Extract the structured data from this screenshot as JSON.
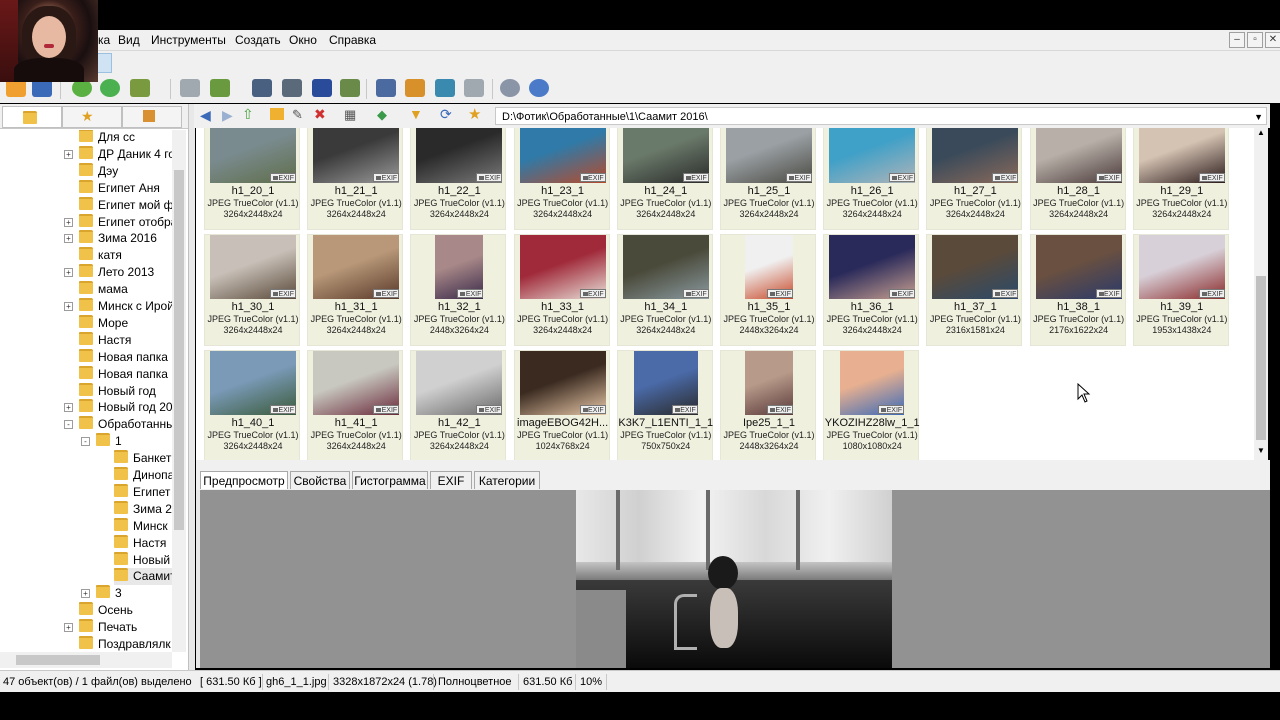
{
  "menu": [
    "Вид",
    "Инструменты",
    "Создать",
    "Окно",
    "Справка"
  ],
  "menu_prefix": "ка",
  "path": "D:\\Фотик\\Обработанные\\1\\Саамит 2016\\",
  "tree": [
    {
      "label": "Для сс",
      "indent": 0,
      "exp": false
    },
    {
      "label": "ДР Даник 4 го,",
      "indent": 0,
      "exp": "+"
    },
    {
      "label": "Дэу",
      "indent": 0,
      "exp": false
    },
    {
      "label": "Египет Аня",
      "indent": 0,
      "exp": false
    },
    {
      "label": "Египет мой фо",
      "indent": 0,
      "exp": false
    },
    {
      "label": "Египет отобра",
      "indent": 0,
      "exp": "+"
    },
    {
      "label": "Зима 2016",
      "indent": 0,
      "exp": "+"
    },
    {
      "label": "катя",
      "indent": 0,
      "exp": false
    },
    {
      "label": "Лето 2013",
      "indent": 0,
      "exp": "+"
    },
    {
      "label": "мама",
      "indent": 0,
      "exp": false
    },
    {
      "label": "Минск с Ирой",
      "indent": 0,
      "exp": "+"
    },
    {
      "label": "Море",
      "indent": 0,
      "exp": false
    },
    {
      "label": "Настя",
      "indent": 0,
      "exp": false
    },
    {
      "label": "Новая папка",
      "indent": 0,
      "exp": false
    },
    {
      "label": "Новая папка (.",
      "indent": 0,
      "exp": false
    },
    {
      "label": "Новый год",
      "indent": 0,
      "exp": false
    },
    {
      "label": "Новый год 20'",
      "indent": 0,
      "exp": "+"
    },
    {
      "label": "Обработанны",
      "indent": 0,
      "exp": "-"
    },
    {
      "label": "1",
      "indent": 1,
      "exp": "-"
    },
    {
      "label": "Банкет",
      "indent": 2,
      "exp": false
    },
    {
      "label": "Динопа",
      "indent": 2,
      "exp": false
    },
    {
      "label": "Египет",
      "indent": 2,
      "exp": false
    },
    {
      "label": "Зима 2(",
      "indent": 2,
      "exp": false
    },
    {
      "label": "Минск",
      "indent": 2,
      "exp": false
    },
    {
      "label": "Настя",
      "indent": 2,
      "exp": false
    },
    {
      "label": "Новый",
      "indent": 2,
      "exp": false
    },
    {
      "label": "Саамит",
      "indent": 2,
      "exp": false,
      "selected": true
    },
    {
      "label": "3",
      "indent": 1,
      "exp": "+"
    },
    {
      "label": "Осень",
      "indent": 0,
      "exp": false
    },
    {
      "label": "Печать",
      "indent": 0,
      "exp": "+"
    },
    {
      "label": "Поздравлялк",
      "indent": 0,
      "exp": false
    }
  ],
  "thumbs": [
    {
      "name": "h1_20_1",
      "fmt": "JPEG TrueColor (v1.1)",
      "dim": "3264x2448x24",
      "c1": "#7a8b8f",
      "c2": "#5f6e4a"
    },
    {
      "name": "h1_21_1",
      "fmt": "JPEG TrueColor (v1.1)",
      "dim": "3264x2448x24",
      "c1": "#3a3a3a",
      "c2": "#9a9a9a"
    },
    {
      "name": "h1_22_1",
      "fmt": "JPEG TrueColor (v1.1)",
      "dim": "3264x2448x24",
      "c1": "#2a2a2a",
      "c2": "#7a7a7a"
    },
    {
      "name": "h1_23_1",
      "fmt": "JPEG TrueColor (v1.1)",
      "dim": "3264x2448x24",
      "c1": "#2f7aa8",
      "c2": "#b84a2a"
    },
    {
      "name": "h1_24_1",
      "fmt": "JPEG TrueColor (v1.1)",
      "dim": "3264x2448x24",
      "c1": "#6a7a6a",
      "c2": "#2a2a2a"
    },
    {
      "name": "h1_25_1",
      "fmt": "JPEG TrueColor (v1.1)",
      "dim": "3264x2448x24",
      "c1": "#9aa0a4",
      "c2": "#4a4a42"
    },
    {
      "name": "h1_26_1",
      "fmt": "JPEG TrueColor (v1.1)",
      "dim": "3264x2448x24",
      "c1": "#3fa0c8",
      "c2": "#b0b4b8"
    },
    {
      "name": "h1_27_1",
      "fmt": "JPEG TrueColor (v1.1)",
      "dim": "3264x2448x24",
      "c1": "#3a4a5a",
      "c2": "#8a6a5a"
    },
    {
      "name": "h1_28_1",
      "fmt": "JPEG TrueColor (v1.1)",
      "dim": "3264x2448x24",
      "c1": "#b8b0a8",
      "c2": "#4a3a3a"
    },
    {
      "name": "h1_29_1",
      "fmt": "JPEG TrueColor (v1.1)",
      "dim": "3264x2448x24",
      "c1": "#d4c2b2",
      "c2": "#2a1a1a"
    },
    {
      "name": "h1_30_1",
      "fmt": "JPEG TrueColor (v1.1)",
      "dim": "3264x2448x24",
      "c1": "#c8c0b8",
      "c2": "#5a4a3a"
    },
    {
      "name": "h1_31_1",
      "fmt": "JPEG TrueColor (v1.1)",
      "dim": "3264x2448x24",
      "c1": "#b89878",
      "c2": "#5a3a2a"
    },
    {
      "name": "h1_32_1",
      "fmt": "JPEG TrueColor (v1.1)",
      "dim": "2448x3264x24",
      "c1": "#a88888",
      "c2": "#3a2a4a"
    },
    {
      "name": "h1_33_1",
      "fmt": "JPEG TrueColor (v1.1)",
      "dim": "3264x2448x24",
      "c1": "#a02a3a",
      "c2": "#e8e0d8"
    },
    {
      "name": "h1_34_1",
      "fmt": "JPEG TrueColor (v1.1)",
      "dim": "3264x2448x24",
      "c1": "#4a4a3a",
      "c2": "#8a9aa0"
    },
    {
      "name": "h1_35_1",
      "fmt": "JPEG TrueColor (v1.1)",
      "dim": "2448x3264x24",
      "c1": "#f0f0f0",
      "c2": "#c84a2a"
    },
    {
      "name": "h1_36_1",
      "fmt": "JPEG TrueColor (v1.1)",
      "dim": "3264x2448x24",
      "c1": "#2a2a5a",
      "c2": "#c8a090"
    },
    {
      "name": "h1_37_1",
      "fmt": "JPEG TrueColor (v1.1)",
      "dim": "2316x1581x24",
      "c1": "#5a4a3a",
      "c2": "#2a4a6a"
    },
    {
      "name": "h1_38_1",
      "fmt": "JPEG TrueColor (v1.1)",
      "dim": "2176x1622x24",
      "c1": "#6a5040",
      "c2": "#2a3a6a"
    },
    {
      "name": "h1_39_1",
      "fmt": "JPEG TrueColor (v1.1)",
      "dim": "1953x1438x24",
      "c1": "#d8d0d8",
      "c2": "#8a2a2a"
    },
    {
      "name": "h1_40_1",
      "fmt": "JPEG TrueColor (v1.1)",
      "dim": "3264x2448x24",
      "c1": "#7a9ab8",
      "c2": "#3a5a3a"
    },
    {
      "name": "h1_41_1",
      "fmt": "JPEG TrueColor (v1.1)",
      "dim": "3264x2448x24",
      "c1": "#c8c8c0",
      "c2": "#6a2a3a"
    },
    {
      "name": "h1_42_1",
      "fmt": "JPEG TrueColor (v1.1)",
      "dim": "3264x2448x24",
      "c1": "#d0d0d0",
      "c2": "#6a6a6a"
    },
    {
      "name": "imageEBOG42H...",
      "fmt": "JPEG TrueColor (v1.1)",
      "dim": "1024x768x24",
      "c1": "#3a2a20",
      "c2": "#e8c8a8"
    },
    {
      "name": "K3K7_L1ENTI_1_1",
      "fmt": "JPEG TrueColor (v1.1)",
      "dim": "750x750x24",
      "c1": "#4a6aa8",
      "c2": "#2a2a2a"
    },
    {
      "name": "Ipe25_1_1",
      "fmt": "JPEG TrueColor (v1.1)",
      "dim": "2448x3264x24",
      "c1": "#b89a8a",
      "c2": "#5a3a3a"
    },
    {
      "name": "YKOZIHZ28lw_1_1",
      "fmt": "JPEG TrueColor (v1.1)",
      "dim": "1080x1080x24",
      "c1": "#e8b090",
      "c2": "#3a6ab8"
    }
  ],
  "exif_badge": "EXIF",
  "preview_tabs": [
    "Предпросмотр",
    "Свойства",
    "Гистограмма",
    "EXIF",
    "Категории"
  ],
  "status": {
    "objects": "47 объект(ов) / 1 файл(ов) выделено",
    "size_sel": "[ 631.50 Кб ]",
    "file": "gh6_1_1.jpg",
    "dims": "3328x1872x24 (1.78)",
    "color": "Полноцветное",
    "size": "631.50 Кб",
    "zoom": "10%"
  },
  "colors": {
    "accent": "#f1c24a",
    "thumb_bg": "#f0f0df",
    "preview_bg": "#929292"
  }
}
